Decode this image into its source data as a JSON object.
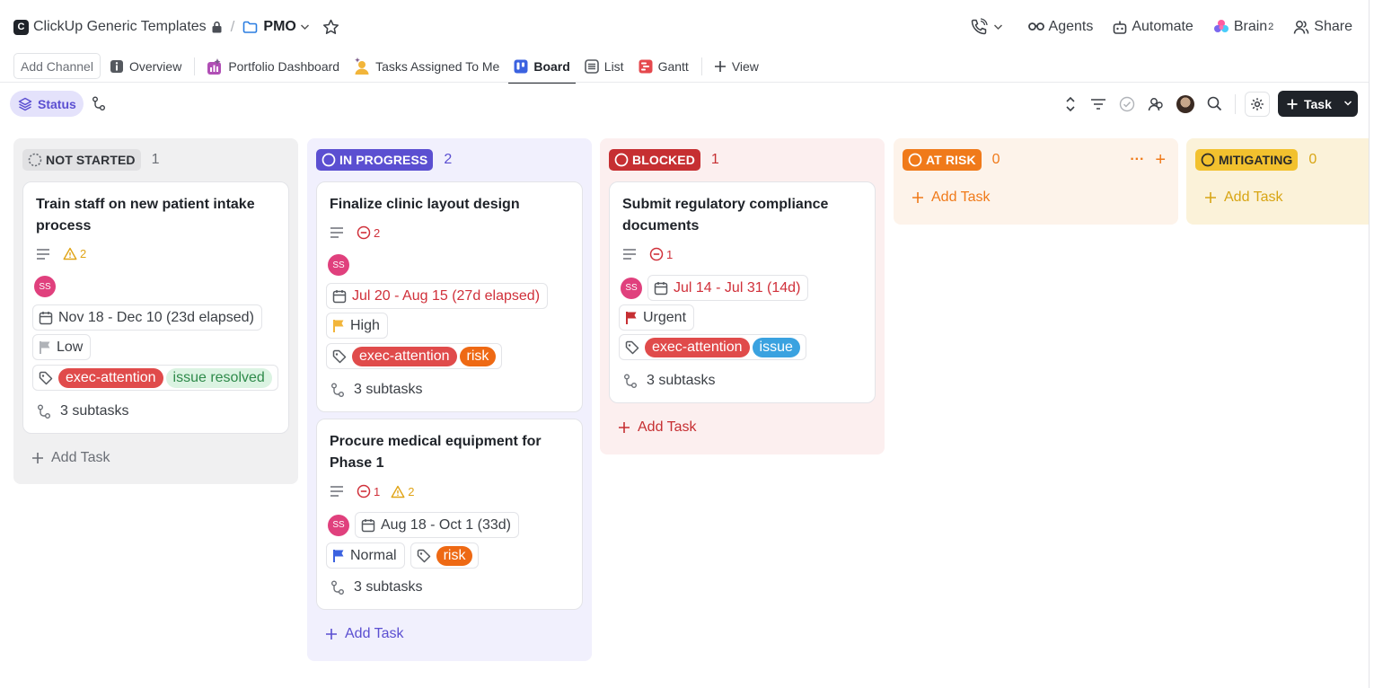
{
  "breadcrumb": {
    "workspace_letter": "C",
    "workspace": "ClickUp Generic Templates",
    "separator": "/",
    "folder": "PMO"
  },
  "header_actions": {
    "agents": "Agents",
    "automate": "Automate",
    "brain": "Brain",
    "brain_sup": "2",
    "share": "Share"
  },
  "tabs": {
    "add_channel": "Add Channel",
    "overview": "Overview",
    "portfolio": "Portfolio Dashboard",
    "assigned": "Tasks Assigned To Me",
    "board": "Board",
    "list": "List",
    "gantt": "Gantt",
    "view": "View"
  },
  "toolbar": {
    "group_by": "Status",
    "task_button": "Task"
  },
  "colors": {
    "not_started": "#e8e8ea",
    "in_progress": "#5b4fd1",
    "blocked": "#c62f32",
    "at_risk": "#f07a1a",
    "mitigating": "#f2c12e"
  },
  "columns": [
    {
      "status": "NOT STARTED",
      "count": "1",
      "add_task": "Add Task",
      "cards": [
        {
          "title": "Train staff on new patient intake process",
          "warnings": "2",
          "assignee": "SS",
          "dates": "Nov 18 - Dec 10 (23d elapsed)",
          "priority": "Low",
          "tags": [
            "exec-attention",
            "issue resolved"
          ],
          "subtasks": "3 subtasks"
        }
      ]
    },
    {
      "status": "IN PROGRESS",
      "count": "2",
      "add_task": "Add Task",
      "cards": [
        {
          "title": "Finalize clinic layout design",
          "blocking": "2",
          "assignee": "SS",
          "dates": "Jul 20 - Aug 15 (27d elapsed)",
          "priority": "High",
          "tags": [
            "exec-attention",
            "risk"
          ],
          "subtasks": "3 subtasks"
        },
        {
          "title": "Procure medical equipment for Phase 1",
          "blocking": "1",
          "warnings": "2",
          "assignee": "SS",
          "dates": "Aug 18 - Oct 1 (33d)",
          "priority": "Normal",
          "tags": [
            "risk"
          ],
          "subtasks": "3 subtasks"
        }
      ]
    },
    {
      "status": "BLOCKED",
      "count": "1",
      "add_task": "Add Task",
      "cards": [
        {
          "title": "Submit regulatory compliance documents",
          "blocking": "1",
          "assignee": "SS",
          "dates": "Jul 14 - Jul 31 (14d)",
          "priority": "Urgent",
          "tags": [
            "exec-attention",
            "issue"
          ],
          "subtasks": "3 subtasks"
        }
      ]
    },
    {
      "status": "AT RISK",
      "count": "0",
      "add_task": "Add Task",
      "more": "···",
      "plus": "+",
      "cards": []
    },
    {
      "status": "MITIGATING",
      "count": "0",
      "add_task": "Add Task",
      "cards": []
    }
  ]
}
